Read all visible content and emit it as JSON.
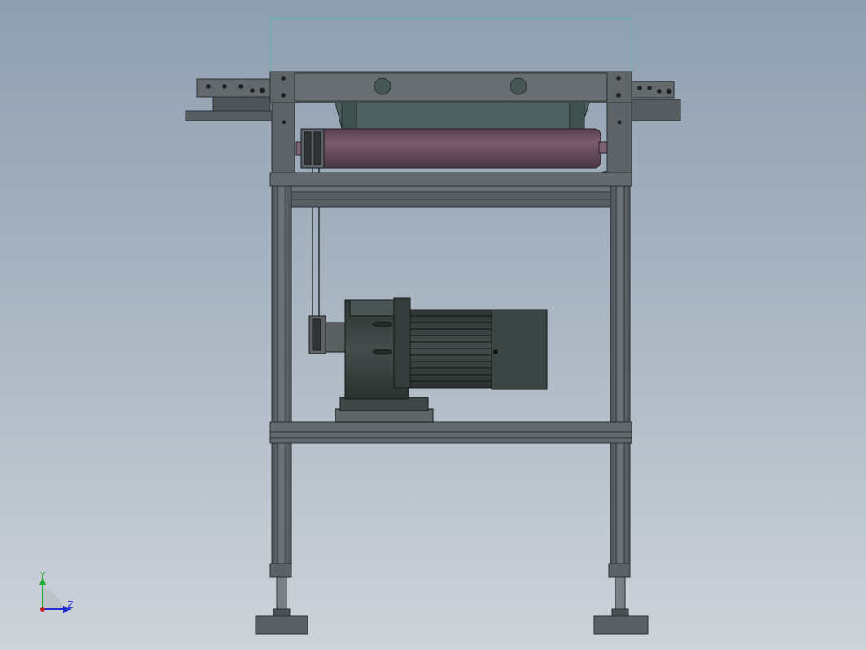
{
  "viewport": {
    "background_top": "#8f9fb1",
    "background_bottom": "#cdd3d9"
  },
  "model": {
    "frame_color": "#5f6569",
    "frame_edge": "#2c3134",
    "roller_color": "#6e4f63",
    "motor_color": "#3d4644",
    "belt_color": "#4d6260"
  },
  "triad": {
    "y_label": "Y",
    "z_label": "Z",
    "y_color": "#1fae3a",
    "z_color": "#1f2fd0",
    "origin_color": "#c0272d"
  }
}
